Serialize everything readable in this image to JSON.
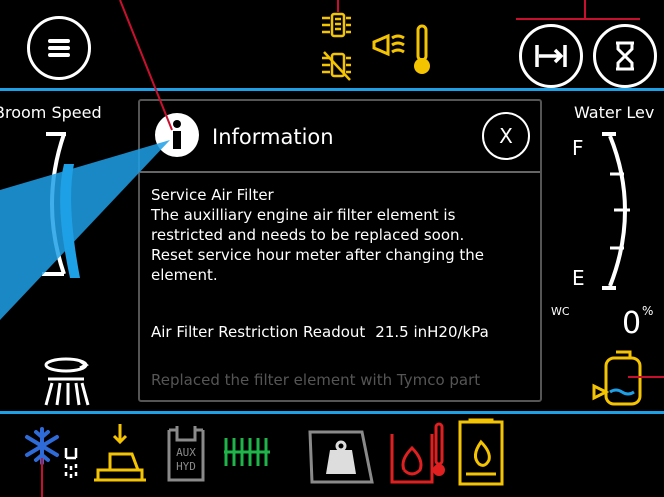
{
  "header": {
    "left_label": "Broom Speed",
    "right_label": "Water Lev"
  },
  "water_gauge": {
    "full_mark": "F",
    "empty_mark": "E",
    "wc_label": "WC",
    "percent_value": "0",
    "percent_unit": "%"
  },
  "broom_speed_gauge": {
    "level_fraction": 0.5
  },
  "dialog": {
    "title": "Information",
    "close_label": "X",
    "heading": "Service Air Filter",
    "message_lines": [
      "The auxilliary engine air filter element is",
      "restricted and needs to be replaced soon.",
      "Reset service hour meter after changing the",
      "element."
    ],
    "readout_label": "Air Filter Restriction Readout",
    "readout_value": "21.5 inH20/kPa",
    "faded_text": "Replaced the filter element with Tymco part"
  },
  "bottom_bar": {
    "aux_hyd_line1": "AUX",
    "aux_hyd_line2": "HYD"
  },
  "colors": {
    "accent_blue": "#1ea0e6",
    "warning_yellow": "#f5c400",
    "alert_red": "#e02020",
    "ok_green": "#1fb34a",
    "gray_icon": "#8a8a8a",
    "annotation_red": "#c8102e"
  }
}
